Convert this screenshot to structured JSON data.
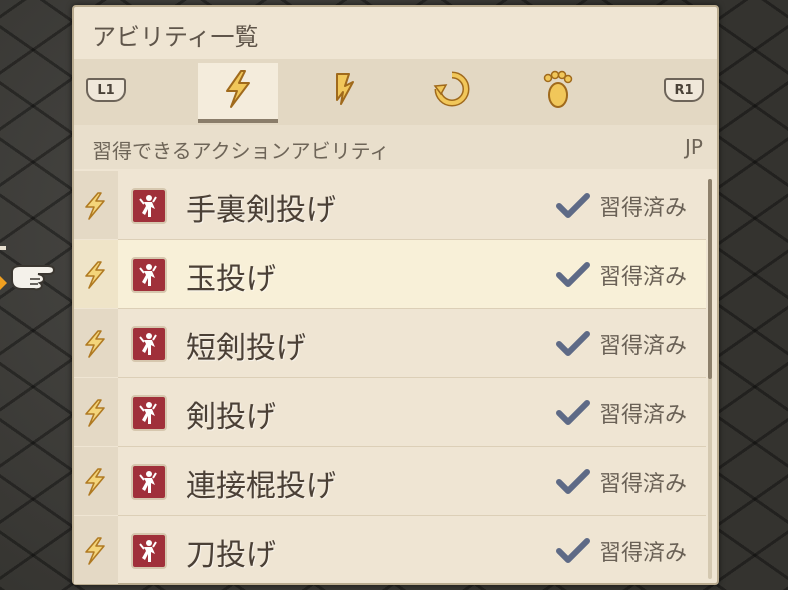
{
  "window": {
    "title": "アビリティ一覧"
  },
  "tabs": {
    "left_shoulder": "L1",
    "right_shoulder": "R1",
    "items": [
      {
        "icon": "action-bolt-icon",
        "active": true
      },
      {
        "icon": "support-bolt-icon",
        "active": false
      },
      {
        "icon": "reaction-icon",
        "active": false
      },
      {
        "icon": "movement-foot-icon",
        "active": false
      }
    ]
  },
  "section": {
    "label": "習得できるアクションアビリティ",
    "cost_header": "JP"
  },
  "abilities": [
    {
      "name": "手裏剣投げ",
      "status": "習得済み",
      "selected": false
    },
    {
      "name": "玉投げ",
      "status": "習得済み",
      "selected": true
    },
    {
      "name": "短剣投げ",
      "status": "習得済み",
      "selected": false
    },
    {
      "name": "剣投げ",
      "status": "習得済み",
      "selected": false
    },
    {
      "name": "連接棍投げ",
      "status": "習得済み",
      "selected": false
    },
    {
      "name": "刀投げ",
      "status": "習得済み",
      "selected": false
    }
  ],
  "colors": {
    "panel": "#efe5d3",
    "badge": "#a0303a",
    "check": "#5e6a86",
    "bolt": "#e3a52a"
  }
}
